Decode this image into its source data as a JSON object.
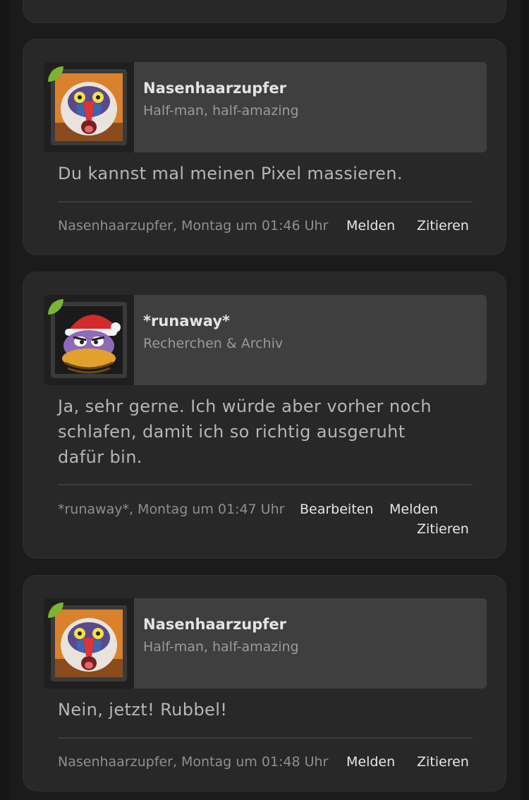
{
  "posts": [
    {
      "username": "Nasenhaarzupfer",
      "usertitle": "Half-man, half-amazing",
      "avatar_icon": "mandrill-avatar-icon",
      "message": "Du kannst mal meinen Pixel massieren.",
      "meta": "Nasenhaarzupfer, Montag um 01:46 Uhr",
      "actions": [
        "Melden",
        "Zitieren"
      ]
    },
    {
      "username": "*runaway*",
      "usertitle": "Recherchen & Archiv",
      "avatar_icon": "santa-duck-avatar-icon",
      "message_lines": [
        "Ja, sehr gerne. Ich würde aber vorher noch",
        "schlafen, damit ich so richtig ausgeruht",
        "dafür bin."
      ],
      "meta": "*runaway*, Montag um 01:47 Uhr",
      "actions": [
        "Bearbeiten",
        "Melden",
        "Zitieren"
      ]
    },
    {
      "username": "Nasenhaarzupfer",
      "usertitle": "Half-man, half-amazing",
      "avatar_icon": "mandrill-avatar-icon",
      "message": "Nein, jetzt! Rubbel!",
      "meta": "Nasenhaarzupfer, Montag um 01:48 Uhr",
      "actions": [
        "Melden",
        "Zitieren"
      ]
    }
  ],
  "colors": {
    "background": "#1b1b1b",
    "card": "#282828",
    "userbox": "#3f3f3f",
    "online_indicator": "#7bb52f"
  }
}
